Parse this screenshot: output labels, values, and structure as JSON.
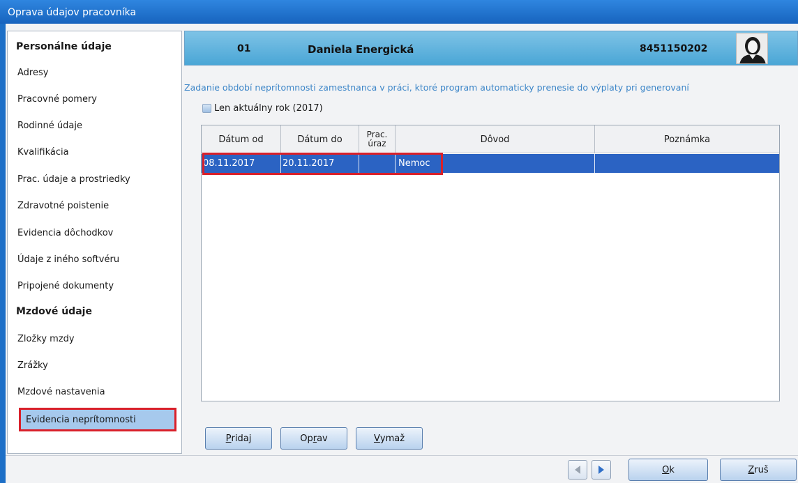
{
  "window": {
    "title": "Oprava údajov pracovníka"
  },
  "sidebar": {
    "section_personal": "Personálne údaje",
    "personal_items": [
      "Adresy",
      "Pracovné pomery",
      "Rodinné údaje",
      "Kvalifikácia",
      "Prac. údaje a prostriedky",
      "Zdravotné poistenie",
      "Evidencia dôchodkov",
      "Údaje z iného softvéru",
      "Pripojené dokumenty"
    ],
    "section_wage": "Mzdové údaje",
    "wage_items": [
      "Zložky mzdy",
      "Zrážky",
      "Mzdové nastavenia",
      "Evidencia neprítomnosti"
    ],
    "selected": "Evidencia neprítomnosti"
  },
  "header": {
    "number": "01",
    "name": "Daniela Energická",
    "id": "8451150202"
  },
  "content": {
    "info": "Zadanie období neprítomnosti zamestnanca v práci, ktoré program automaticky prenesie do výplaty pri generovaní",
    "checkbox_label": "Len aktuálny rok (2017)",
    "checkbox_checked": false
  },
  "table": {
    "columns": [
      "Dátum od",
      "Dátum do",
      "Prac.\núraz",
      "Dôvod",
      "Poznámka"
    ],
    "rows": [
      [
        "08.11.2017",
        "20.11.2017",
        "",
        "Nemoc",
        ""
      ]
    ]
  },
  "buttons": {
    "add": {
      "mnemonic": "P",
      "rest": "ridaj"
    },
    "edit": {
      "pre": "Op",
      "mnemonic": "r",
      "rest": "av"
    },
    "delete": {
      "mnemonic": "V",
      "rest": "ymaž"
    },
    "ok": {
      "mnemonic": "O",
      "rest": "k"
    },
    "cancel": {
      "mnemonic": "Z",
      "rest": "ruš"
    }
  },
  "colors": {
    "titlebar": "#1d6fc7",
    "selection": "#2b63c3",
    "highlight_border": "#d9202a",
    "info_text": "#3d86c8",
    "header_band": "#5fb2de"
  }
}
